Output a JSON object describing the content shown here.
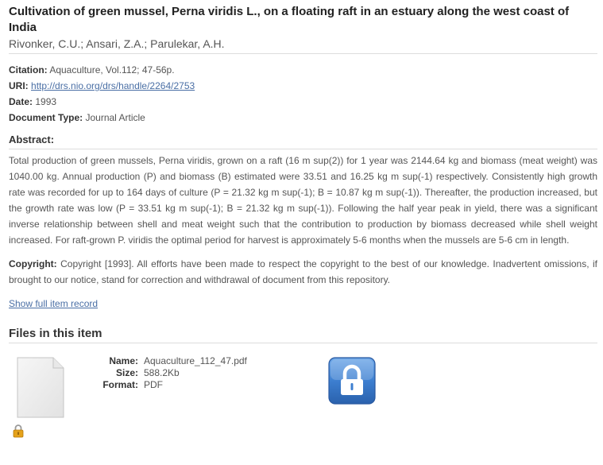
{
  "item": {
    "title": "Cultivation of green mussel, Perna viridis L., on a floating raft in an estuary along the west coast of India",
    "authors": "Rivonker, C.U.; Ansari, Z.A.; Parulekar, A.H."
  },
  "metadata": {
    "citation_label": "Citation:",
    "citation_value": "Aquaculture, Vol.112; 47-56p.",
    "uri_label": "URI:",
    "uri_value": "http://drs.nio.org/drs/handle/2264/2753",
    "date_label": "Date:",
    "date_value": "1993",
    "doctype_label": "Document Type:",
    "doctype_value": "Journal Article"
  },
  "abstract": {
    "heading": "Abstract:",
    "text": "Total production of green mussels, Perna viridis, grown on a raft (16 m sup(2)) for 1 year was 2144.64 kg and biomass (meat weight) was 1040.00 kg. Annual production (P) and biomass (B) estimated were 33.51 and 16.25 kg m sup(-1) respectively. Consistently high growth rate was recorded for up to 164 days of culture (P = 21.32 kg m sup(-1); B = 10.87 kg m sup(-1)). Thereafter, the production increased, but the growth rate was low (P = 33.51 kg m sup(-1); B = 21.32 kg m sup(-1)). Following the half year peak in yield, there was a significant inverse relationship between shell and meat weight such that the contribution to production by biomass decreased while shell weight increased. For raft-grown P. viridis the optimal period for harvest is approximately 5-6 months when the mussels are 5-6 cm in length."
  },
  "copyright": {
    "label": "Copyright:",
    "text": "Copyright [1993]. All efforts have been made to respect the copyright to the best of our knowledge. Inadvertent omissions, if brought to our notice, stand for correction and withdrawal of document from this repository."
  },
  "links": {
    "full_record": "Show full item record"
  },
  "files": {
    "heading": "Files in this item",
    "name_label": "Name:",
    "name_value": "Aquaculture_112_47.pdf",
    "size_label": "Size:",
    "size_value": "588.2Kb",
    "format_label": "Format:",
    "format_value": "PDF"
  },
  "icons": {
    "thumbnail": "document-thumbnail-icon",
    "restricted": "lock-icon",
    "access": "padlock-access-icon"
  },
  "colors": {
    "link": "#4a6fa5",
    "lock_blue": "#3d7fd0",
    "lock_gold": "#e5a21a"
  }
}
